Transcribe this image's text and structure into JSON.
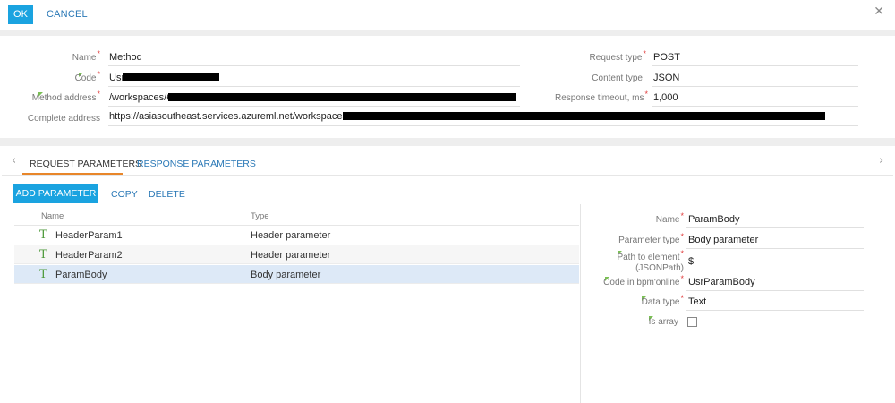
{
  "toolbar": {
    "ok_label": "OK",
    "cancel_label": "CANCEL",
    "close_glyph": "✕"
  },
  "method": {
    "name_label": "Name",
    "name_value": "Method",
    "code_label": "Code",
    "code_value": "Usr",
    "method_address_label": "Method address",
    "method_address_value": "/workspaces/64",
    "complete_address_label": "Complete address",
    "complete_address_value": "https://asiasoutheast.services.azureml.net/workspaces/64faa",
    "request_type_label": "Request type",
    "request_type_value": "POST",
    "content_type_label": "Content type",
    "content_type_value": "JSON",
    "response_timeout_label": "Response timeout, ms",
    "response_timeout_value": "1,000"
  },
  "tabs": [
    {
      "label": "REQUEST PARAMETERS",
      "active": true
    },
    {
      "label": "RESPONSE PARAMETERS",
      "active": false
    }
  ],
  "actions": {
    "add_label": "ADD PARAMETER",
    "copy_label": "COPY",
    "delete_label": "DELETE"
  },
  "grid": {
    "columns": [
      "Name",
      "Type"
    ],
    "rows": [
      {
        "name": "HeaderParam1",
        "type": "Header parameter"
      },
      {
        "name": "HeaderParam2",
        "type": "Header parameter"
      },
      {
        "name": "ParamBody",
        "type": "Body parameter",
        "selected": true
      }
    ],
    "row_icon": "text-type-icon",
    "row_icon_glyph": "T"
  },
  "details": {
    "name_label": "Name",
    "name_value": "ParamBody",
    "param_type_label": "Parameter type",
    "param_type_value": "Body parameter",
    "path_label_line1": "Path to element",
    "path_label_line2": "(JSONPath)",
    "path_value": "$",
    "code_label": "Code in bpm'online",
    "code_value": "UsrParamBody",
    "data_type_label": "Data type",
    "data_type_value": "Text",
    "is_array_label": "Is array",
    "is_array_checked": false
  },
  "colors": {
    "accent": "#1aa3e0",
    "link": "#2a78b6",
    "tab_underline": "#e8862a",
    "required": "#e03b3b",
    "indicator": "#7bbf55",
    "selected_row": "#dde9f7"
  }
}
